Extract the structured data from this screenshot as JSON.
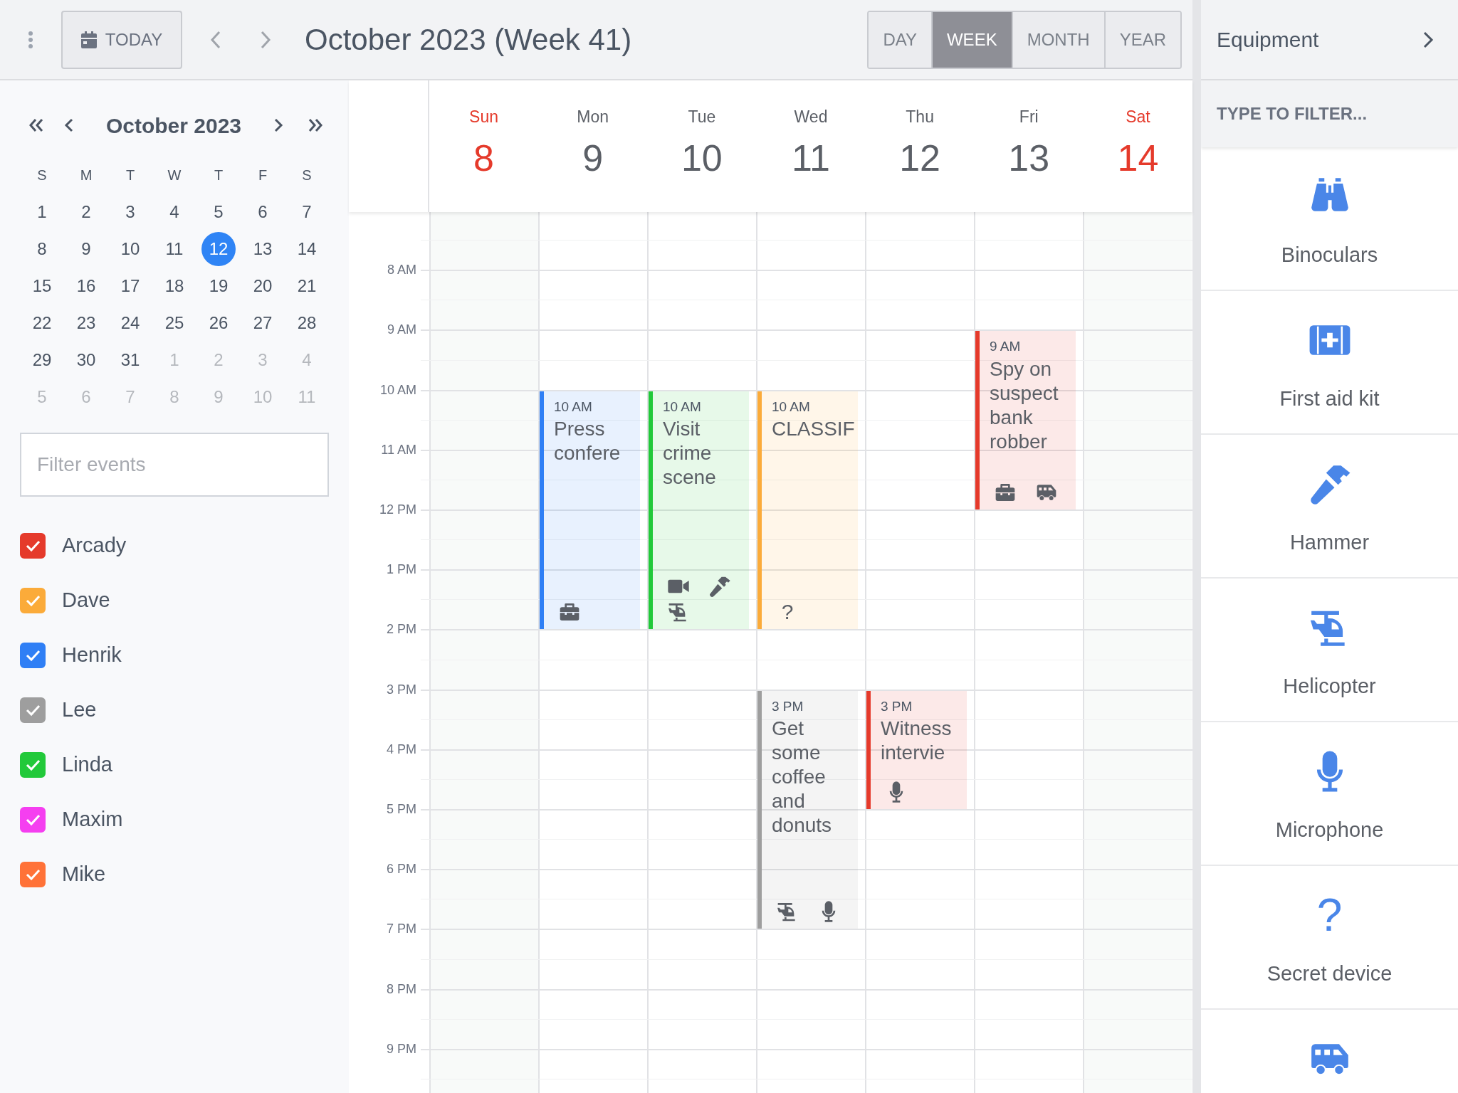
{
  "toolbar": {
    "today": "TODAY",
    "title": "October 2023 (Week 41)",
    "views": [
      {
        "label": "DAY",
        "selected": false
      },
      {
        "label": "WEEK",
        "selected": true
      },
      {
        "label": "MONTH",
        "selected": false
      },
      {
        "label": "YEAR",
        "selected": false
      }
    ]
  },
  "mini_calendar": {
    "title": "October 2023",
    "weekdays": [
      "S",
      "M",
      "T",
      "W",
      "T",
      "F",
      "S"
    ],
    "weeks": [
      [
        {
          "label": "1",
          "muted": false,
          "selected": false
        },
        {
          "label": "2",
          "muted": false,
          "selected": false
        },
        {
          "label": "3",
          "muted": false,
          "selected": false
        },
        {
          "label": "4",
          "muted": false,
          "selected": false
        },
        {
          "label": "5",
          "muted": false,
          "selected": false
        },
        {
          "label": "6",
          "muted": false,
          "selected": false
        },
        {
          "label": "7",
          "muted": false,
          "selected": false
        }
      ],
      [
        {
          "label": "8",
          "muted": false,
          "selected": false
        },
        {
          "label": "9",
          "muted": false,
          "selected": false
        },
        {
          "label": "10",
          "muted": false,
          "selected": false
        },
        {
          "label": "11",
          "muted": false,
          "selected": false
        },
        {
          "label": "12",
          "muted": false,
          "selected": true
        },
        {
          "label": "13",
          "muted": false,
          "selected": false
        },
        {
          "label": "14",
          "muted": false,
          "selected": false
        }
      ],
      [
        {
          "label": "15",
          "muted": false,
          "selected": false
        },
        {
          "label": "16",
          "muted": false,
          "selected": false
        },
        {
          "label": "17",
          "muted": false,
          "selected": false
        },
        {
          "label": "18",
          "muted": false,
          "selected": false
        },
        {
          "label": "19",
          "muted": false,
          "selected": false
        },
        {
          "label": "20",
          "muted": false,
          "selected": false
        },
        {
          "label": "21",
          "muted": false,
          "selected": false
        }
      ],
      [
        {
          "label": "22",
          "muted": false,
          "selected": false
        },
        {
          "label": "23",
          "muted": false,
          "selected": false
        },
        {
          "label": "24",
          "muted": false,
          "selected": false
        },
        {
          "label": "25",
          "muted": false,
          "selected": false
        },
        {
          "label": "26",
          "muted": false,
          "selected": false
        },
        {
          "label": "27",
          "muted": false,
          "selected": false
        },
        {
          "label": "28",
          "muted": false,
          "selected": false
        }
      ],
      [
        {
          "label": "29",
          "muted": false,
          "selected": false
        },
        {
          "label": "30",
          "muted": false,
          "selected": false
        },
        {
          "label": "31",
          "muted": false,
          "selected": false
        },
        {
          "label": "1",
          "muted": true,
          "selected": false
        },
        {
          "label": "2",
          "muted": true,
          "selected": false
        },
        {
          "label": "3",
          "muted": true,
          "selected": false
        },
        {
          "label": "4",
          "muted": true,
          "selected": false
        }
      ],
      [
        {
          "label": "5",
          "muted": true,
          "selected": false
        },
        {
          "label": "6",
          "muted": true,
          "selected": false
        },
        {
          "label": "7",
          "muted": true,
          "selected": false
        },
        {
          "label": "8",
          "muted": true,
          "selected": false
        },
        {
          "label": "9",
          "muted": true,
          "selected": false
        },
        {
          "label": "10",
          "muted": true,
          "selected": false
        },
        {
          "label": "11",
          "muted": true,
          "selected": false
        }
      ]
    ]
  },
  "event_filter": {
    "placeholder": "Filter events"
  },
  "calendars": [
    {
      "label": "Arcady",
      "checked": true,
      "color": "#e53a2b"
    },
    {
      "label": "Dave",
      "checked": true,
      "color": "#fbab3a"
    },
    {
      "label": "Henrik",
      "checked": true,
      "color": "#2f7ff5"
    },
    {
      "label": "Lee",
      "checked": true,
      "color": "#9e9e9e"
    },
    {
      "label": "Linda",
      "checked": true,
      "color": "#22c93a"
    },
    {
      "label": "Maxim",
      "checked": true,
      "color": "#f53ff0"
    },
    {
      "label": "Mike",
      "checked": true,
      "color": "#ff7238"
    }
  ],
  "hours": [
    "8 AM",
    "9 AM",
    "10 AM",
    "11 AM",
    "12 PM",
    "1 PM",
    "2 PM",
    "3 PM",
    "4 PM",
    "5 PM",
    "6 PM",
    "7 PM",
    "8 PM",
    "9 PM"
  ],
  "days": [
    {
      "name": "Sun",
      "number": "8",
      "weekend": true
    },
    {
      "name": "Mon",
      "number": "9",
      "weekend": false,
      "events": [
        {
          "time": "10 AM",
          "title": "Press confere",
          "kind": "four-hour",
          "color": "#2f7ff5",
          "equipment": [
            {
              "kind": "toolbox"
            }
          ]
        }
      ]
    },
    {
      "name": "Tue",
      "number": "10",
      "weekend": false,
      "events": [
        {
          "time": "10 AM",
          "title": "Visit crime scene",
          "kind": "four-hour",
          "color": "#22c93a",
          "equipment": [
            {
              "kind": "camera"
            },
            {
              "kind": "hammer"
            },
            {
              "kind": "helicopter"
            }
          ]
        }
      ]
    },
    {
      "name": "Wed",
      "number": "11",
      "weekend": false,
      "events": [
        {
          "time": "10 AM",
          "title": "CLASSIF",
          "kind": "four-hour",
          "color": "#fbab3a",
          "equipment": [
            {
              "kind": "secret",
              "symbol": "?"
            }
          ]
        },
        {
          "time": "3 PM",
          "title": "Get some coffee and donuts",
          "kind": "four-hour",
          "color": "#9e9e9e",
          "equipment": [
            {
              "kind": "helicopter"
            },
            {
              "kind": "microphone"
            }
          ]
        }
      ]
    },
    {
      "name": "Thu",
      "number": "12",
      "weekend": false,
      "events": [
        {
          "time": "3 PM",
          "title": "Witness intervie",
          "kind": "two-hour",
          "color": "#e53a2b",
          "equipment": [
            {
              "kind": "microphone"
            }
          ]
        }
      ]
    },
    {
      "name": "Fri",
      "number": "13",
      "weekend": false,
      "events": [
        {
          "time": "9 AM",
          "title": "Spy on suspect bank robber",
          "kind": "three-hour",
          "color": "#e53a2b",
          "equipment": [
            {
              "kind": "toolbox"
            },
            {
              "kind": "van"
            }
          ]
        }
      ]
    },
    {
      "name": "Sat",
      "number": "14",
      "weekend": true
    }
  ],
  "equipment_panel": {
    "title": "Equipment",
    "filter_placeholder": "TYPE TO FILTER...",
    "items": [
      {
        "label": "Binoculars",
        "kind": "binoculars"
      },
      {
        "label": "First aid kit",
        "kind": "first-aid"
      },
      {
        "label": "Hammer",
        "kind": "hammer"
      },
      {
        "label": "Helicopter",
        "kind": "helicopter"
      },
      {
        "label": "Microphone",
        "kind": "microphone"
      },
      {
        "label": "Secret device",
        "kind": "secret",
        "symbol": "?"
      },
      {
        "kind": "van"
      }
    ]
  }
}
